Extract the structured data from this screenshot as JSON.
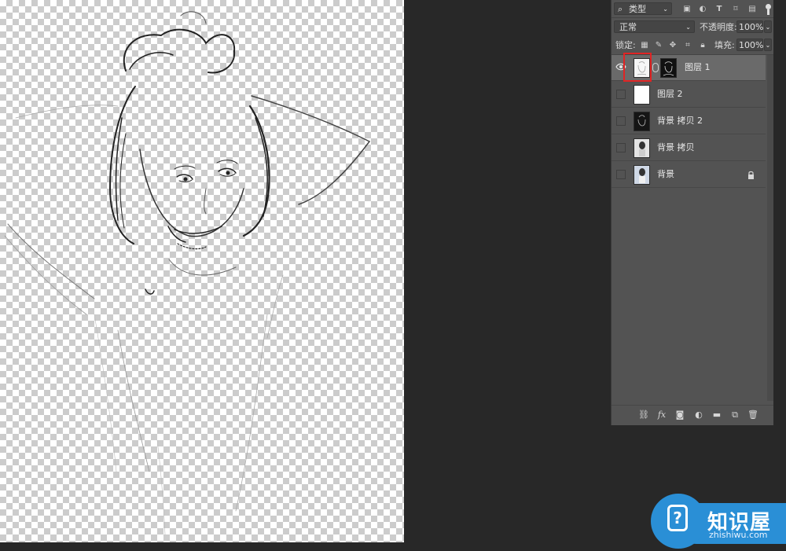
{
  "layers_panel": {
    "filter": {
      "icon": "search-icon",
      "value": "类型"
    },
    "filter_icons": [
      "image-filter-icon",
      "adjustment-filter-icon",
      "text-filter-icon",
      "shape-filter-icon",
      "smart-object-filter-icon"
    ],
    "blend_mode": "正常",
    "opacity_label": "不透明度:",
    "opacity_value": "100%",
    "lock_label": "锁定:",
    "fill_label": "填充:",
    "fill_value": "100%",
    "layers": [
      {
        "name": "图层 1",
        "visible": true,
        "active": true,
        "has_mask": true
      },
      {
        "name": "图层 2",
        "visible": false,
        "active": false
      },
      {
        "name": "背景 拷贝 2",
        "visible": false,
        "active": false
      },
      {
        "name": "背景 拷贝",
        "visible": false,
        "active": false
      },
      {
        "name": "背景",
        "visible": false,
        "active": false,
        "locked": true
      }
    ],
    "footer_icons": [
      "link-icon",
      "fx-icon",
      "mask-icon",
      "adjustment-icon",
      "folder-icon",
      "new-layer-icon",
      "trash-icon"
    ]
  },
  "watermark": {
    "brand": "知识屋",
    "site": "zhishiwu.com"
  },
  "colors": {
    "app_bg": "#282828",
    "panel_bg": "#535353",
    "active_layer": "#6a6a6a",
    "highlight_box": "#e02424",
    "logo_blue": "#2a8fd6"
  }
}
